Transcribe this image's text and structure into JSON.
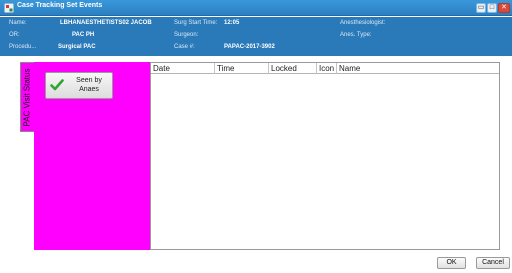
{
  "window": {
    "title": "Case Tracking Set Events",
    "minimize": "▭",
    "maximize": "□",
    "close": "✕"
  },
  "header": {
    "name_label": "Name:",
    "name_value": "LBHANAESTHETISTS02 JACOB",
    "or_label": "OR:",
    "or_value": "PAC PH",
    "procedure_label": "Procedu...",
    "procedure_value": "Surgical PAC",
    "surg_start_label": "Surg Start Time:",
    "surg_start_value": "12:05",
    "surgeon_label": "Surgeon:",
    "surgeon_value": "",
    "case_label": "Case #:",
    "case_value": "PAPAC-2017-3902",
    "anesthesiologist_label": "Anesthesiologist:",
    "anesthesiologist_value": "",
    "anes_type_label": "Anes. Type:",
    "anes_type_value": ""
  },
  "tab": {
    "label": "PAC Visit Status"
  },
  "event_button": {
    "label": "Seen by\nAnaes",
    "icon": "check-icon"
  },
  "table": {
    "columns": [
      "Date",
      "Time",
      "Locked",
      "Icon",
      "Name"
    ],
    "rows": []
  },
  "buttons": {
    "ok": "OK",
    "cancel": "Cancel"
  },
  "colors": {
    "title_bar": "#2b7fc1",
    "header_bg": "#2a79b9",
    "panel": "#ff00ff",
    "check": "#2fa52f"
  }
}
